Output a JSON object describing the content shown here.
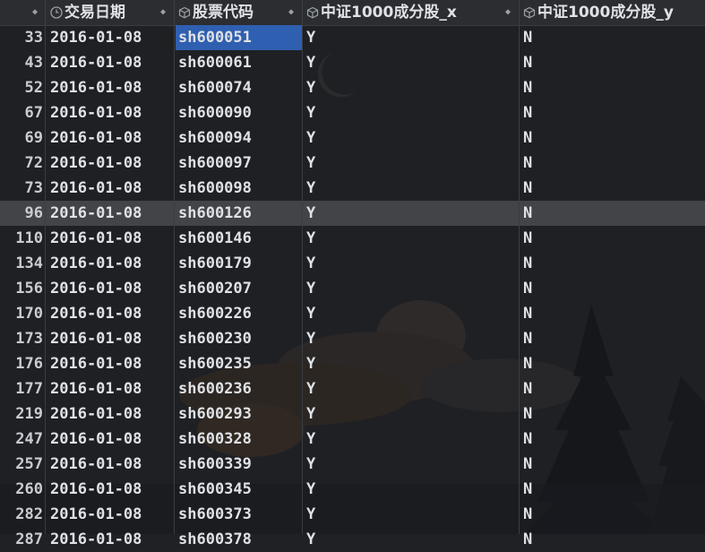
{
  "columns": {
    "date": "交易日期",
    "code": "股票代码",
    "x": "中证1000成分股_x",
    "y": "中证1000成分股_y"
  },
  "rows": [
    {
      "idx": "33",
      "date": "2016-01-08",
      "code": "sh600051",
      "x": "Y",
      "y": "N"
    },
    {
      "idx": "43",
      "date": "2016-01-08",
      "code": "sh600061",
      "x": "Y",
      "y": "N"
    },
    {
      "idx": "52",
      "date": "2016-01-08",
      "code": "sh600074",
      "x": "Y",
      "y": "N"
    },
    {
      "idx": "67",
      "date": "2016-01-08",
      "code": "sh600090",
      "x": "Y",
      "y": "N"
    },
    {
      "idx": "69",
      "date": "2016-01-08",
      "code": "sh600094",
      "x": "Y",
      "y": "N"
    },
    {
      "idx": "72",
      "date": "2016-01-08",
      "code": "sh600097",
      "x": "Y",
      "y": "N"
    },
    {
      "idx": "73",
      "date": "2016-01-08",
      "code": "sh600098",
      "x": "Y",
      "y": "N"
    },
    {
      "idx": "96",
      "date": "2016-01-08",
      "code": "sh600126",
      "x": "Y",
      "y": "N"
    },
    {
      "idx": "110",
      "date": "2016-01-08",
      "code": "sh600146",
      "x": "Y",
      "y": "N"
    },
    {
      "idx": "134",
      "date": "2016-01-08",
      "code": "sh600179",
      "x": "Y",
      "y": "N"
    },
    {
      "idx": "156",
      "date": "2016-01-08",
      "code": "sh600207",
      "x": "Y",
      "y": "N"
    },
    {
      "idx": "170",
      "date": "2016-01-08",
      "code": "sh600226",
      "x": "Y",
      "y": "N"
    },
    {
      "idx": "173",
      "date": "2016-01-08",
      "code": "sh600230",
      "x": "Y",
      "y": "N"
    },
    {
      "idx": "176",
      "date": "2016-01-08",
      "code": "sh600235",
      "x": "Y",
      "y": "N"
    },
    {
      "idx": "177",
      "date": "2016-01-08",
      "code": "sh600236",
      "x": "Y",
      "y": "N"
    },
    {
      "idx": "219",
      "date": "2016-01-08",
      "code": "sh600293",
      "x": "Y",
      "y": "N"
    },
    {
      "idx": "247",
      "date": "2016-01-08",
      "code": "sh600328",
      "x": "Y",
      "y": "N"
    },
    {
      "idx": "257",
      "date": "2016-01-08",
      "code": "sh600339",
      "x": "Y",
      "y": "N"
    },
    {
      "idx": "260",
      "date": "2016-01-08",
      "code": "sh600345",
      "x": "Y",
      "y": "N"
    },
    {
      "idx": "282",
      "date": "2016-01-08",
      "code": "sh600373",
      "x": "Y",
      "y": "N"
    },
    {
      "idx": "287",
      "date": "2016-01-08",
      "code": "sh600378",
      "x": "Y",
      "y": "N"
    }
  ],
  "selected_cell": {
    "row": 0,
    "column": "code"
  },
  "highlighted_row": 7,
  "colors": {
    "selection": "#2f5fb0",
    "highlight_row": "#55575c"
  },
  "icons": {
    "date_col": "clock-icon",
    "other_cols": "cube-icon",
    "sort": "sort-arrows-icon"
  }
}
